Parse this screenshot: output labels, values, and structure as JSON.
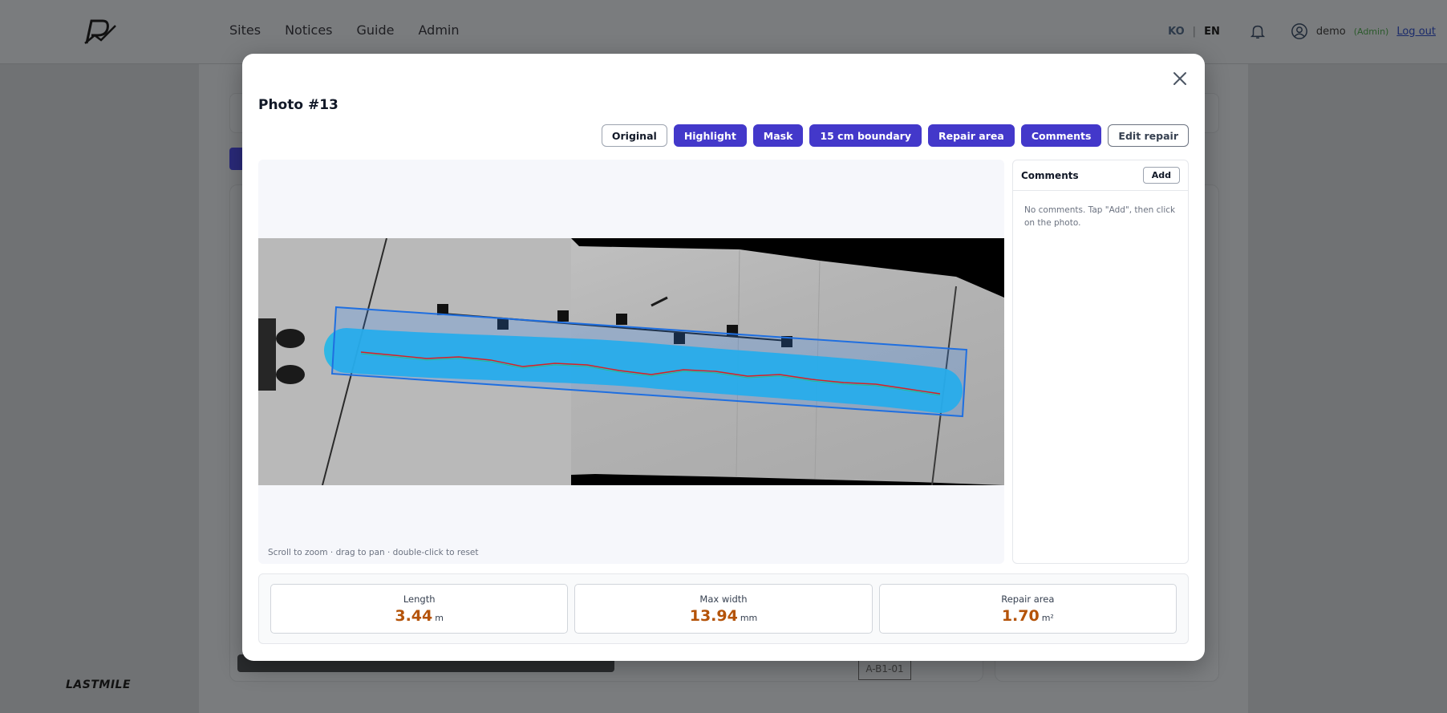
{
  "nav": {
    "items": [
      "Sites",
      "Notices",
      "Guide",
      "Admin"
    ]
  },
  "header": {
    "lang_ko": "KO",
    "lang_sep": "|",
    "lang_en": "EN",
    "user": "demo",
    "role": "(Admin)",
    "logout": "Log out"
  },
  "footer": {
    "brand": "LASTMILE"
  },
  "background": {
    "tag": "A-B1-01"
  },
  "modal": {
    "title": "Photo #13",
    "toolbar": {
      "original": "Original",
      "highlight": "Highlight",
      "mask": "Mask",
      "boundary": "15 cm boundary",
      "repair_area": "Repair area",
      "comments": "Comments",
      "edit_repair": "Edit repair"
    },
    "viewer_hint": "Scroll to zoom · drag to pan · double-click to reset",
    "comments_panel": {
      "title": "Comments",
      "add": "Add",
      "empty": "No comments. Tap \"Add\", then click on the photo."
    },
    "stats": [
      {
        "label": "Length",
        "value": "3.44",
        "unit": "m"
      },
      {
        "label": "Max width",
        "value": "13.94",
        "unit": "mm"
      },
      {
        "label": "Repair area",
        "value": "1.70",
        "unit": "m²"
      }
    ]
  },
  "colors": {
    "accent": "#4338ca",
    "stat_value": "#b45309",
    "mask": "#22b8e6",
    "crack": "#d92020"
  }
}
